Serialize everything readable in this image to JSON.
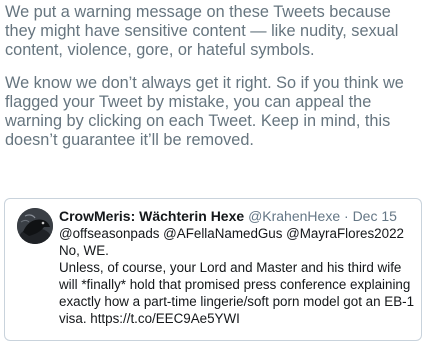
{
  "notice": {
    "paragraph1": "We put a warning message on these Tweets because they might have sensitive content — like nudity, sexual content, violence, gore, or hateful symbols.",
    "paragraph2": "We know we don’t always get it right. So if you think we flagged your Tweet by mistake, you can appeal the warning by clicking on each Tweet. Keep in mind, this doesn’t guarantee it’ll be removed."
  },
  "tweet": {
    "display_name": "CrowMeris: Wächterin Hexe",
    "handle": "@KrahenHexe",
    "separator": "·",
    "date": "Dec 15",
    "avatar_icon": "crow-avatar",
    "lines": [
      "@offseasonpads @AFellaNamedGus @MayraFlores2022",
      "No, WE.",
      "Unless, of course, your Lord and Master and his third wife",
      "will *finally* hold that promised press conference explaining",
      "exactly how a part-time lingerie/soft porn model got an EB-1",
      "visa. https://t.co/EEC9Ae5YWI"
    ]
  },
  "colors": {
    "notice_text": "#66757f",
    "tweet_text": "#14171a",
    "meta_text": "#657786",
    "card_border": "#c9d3dc"
  }
}
